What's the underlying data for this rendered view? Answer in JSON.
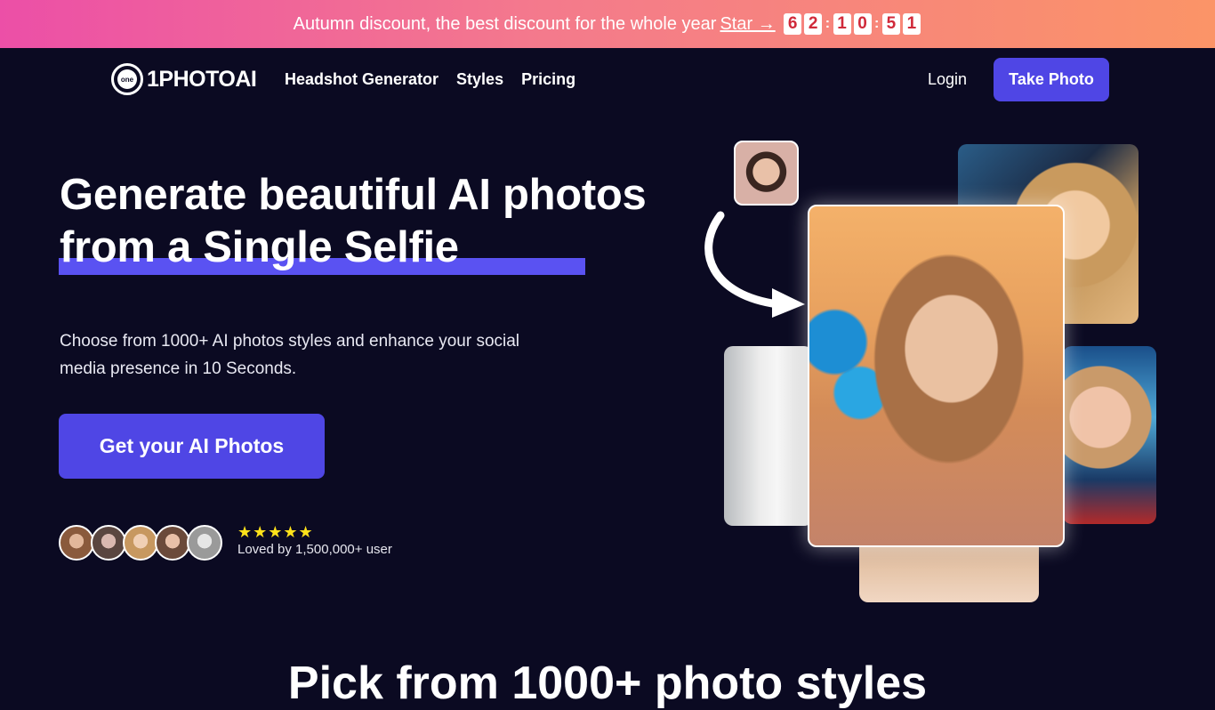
{
  "promo": {
    "message": "Autumn discount, the best discount for the whole year",
    "link": "Star →",
    "countdown": [
      "6",
      "2",
      "1",
      "0",
      "5",
      "1"
    ]
  },
  "nav": {
    "logo_text": "1PHOTOAI",
    "logo_mark": "one",
    "links": [
      "Headshot Generator",
      "Styles",
      "Pricing"
    ],
    "login": "Login",
    "take_photo": "Take Photo"
  },
  "hero": {
    "title_line1": "Generate beautiful AI photos",
    "title_line2": "from a Single Selfie",
    "subtitle": "Choose from 1000+ AI photos styles and enhance your social media presence in 10 Seconds.",
    "cta": "Get your AI Photos",
    "rating_stars": "★★★★★",
    "loved_by": "Loved by 1,500,000+ user"
  },
  "section": {
    "title": "Pick from 1000+ photo styles"
  },
  "colors": {
    "accent": "#4f46e5",
    "background": "#0b0a22",
    "star": "#ffe21a"
  }
}
